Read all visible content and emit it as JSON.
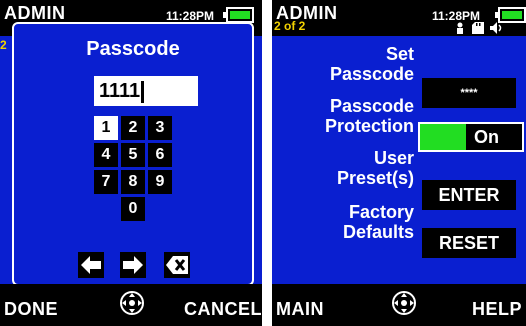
{
  "passcode_screen": {
    "header": {
      "title": "ADMIN",
      "time": "11:28PM",
      "page": "2"
    },
    "dialog": {
      "title": "Passcode",
      "entry_value": "1111",
      "keypad": [
        "1",
        "2",
        "3",
        "4",
        "5",
        "6",
        "7",
        "8",
        "9",
        "0"
      ],
      "selected_key": "1",
      "buttons": [
        "left-arrow-icon",
        "right-arrow-icon",
        "backspace-icon"
      ]
    },
    "footer": {
      "left": "DONE",
      "right": "CANCEL"
    }
  },
  "settings_screen": {
    "header": {
      "title": "ADMIN",
      "time": "11:28PM",
      "page": "2 of 2"
    },
    "rows": [
      {
        "label_line1": "Set",
        "label_line2": "Passcode",
        "value": "****"
      },
      {
        "label_line1": "Passcode",
        "label_line2": "Protection",
        "value": "On"
      },
      {
        "label_line1": "User",
        "label_line2": "Preset(s)",
        "value": "ENTER"
      },
      {
        "label_line1": "Factory",
        "label_line2": "Defaults",
        "value": "RESET"
      }
    ],
    "footer": {
      "left": "MAIN",
      "right": "HELP"
    }
  },
  "status_icons": [
    "battery-icon",
    "user-icon",
    "sd-card-icon",
    "speaker-icon"
  ],
  "colors": {
    "screen_bg": "#0a1fd0",
    "bar_bg": "#000000",
    "accent_green": "#22dd22",
    "page_yellow": "#f2d200"
  }
}
